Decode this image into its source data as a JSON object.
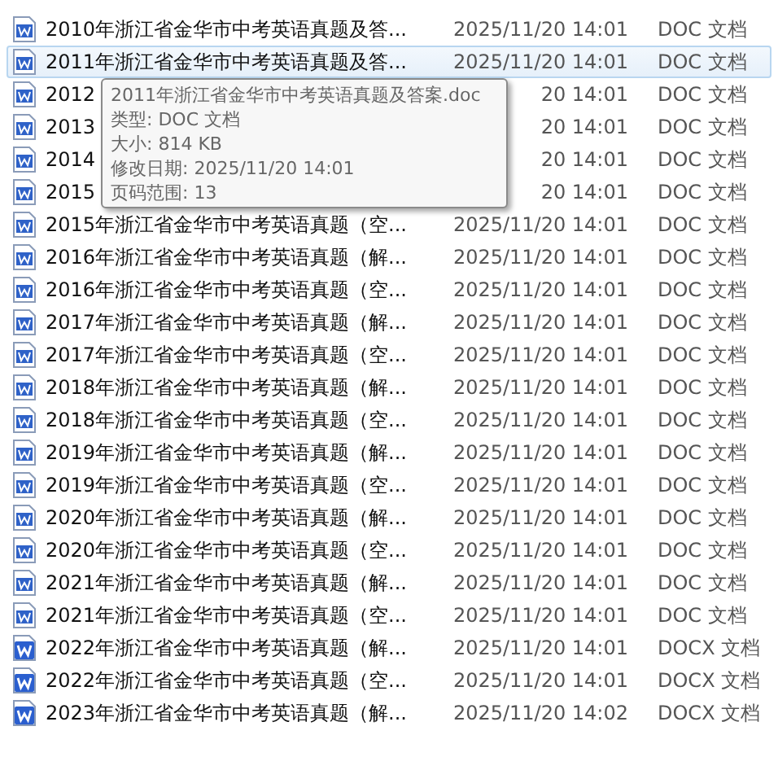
{
  "files": [
    {
      "name": "2010年浙江省金华市中考英语真题及答...",
      "date": "2025/11/20 14:01",
      "type": "DOC 文档",
      "kind": "doc",
      "selected": false
    },
    {
      "name": "2011年浙江省金华市中考英语真题及答...",
      "date": "2025/11/20 14:01",
      "type": "DOC 文档",
      "kind": "doc",
      "selected": true
    },
    {
      "name": "2012",
      "date": "20 14:01",
      "type": "DOC 文档",
      "kind": "doc",
      "selected": false
    },
    {
      "name": "2013",
      "date": "20 14:01",
      "type": "DOC 文档",
      "kind": "doc",
      "selected": false
    },
    {
      "name": "2014",
      "date": "20 14:01",
      "type": "DOC 文档",
      "kind": "doc",
      "selected": false
    },
    {
      "name": "2015",
      "date": "20 14:01",
      "type": "DOC 文档",
      "kind": "doc",
      "selected": false
    },
    {
      "name": "2015年浙江省金华市中考英语真题（空...",
      "date": "2025/11/20 14:01",
      "type": "DOC 文档",
      "kind": "doc",
      "selected": false
    },
    {
      "name": "2016年浙江省金华市中考英语真题（解...",
      "date": "2025/11/20 14:01",
      "type": "DOC 文档",
      "kind": "doc",
      "selected": false
    },
    {
      "name": "2016年浙江省金华市中考英语真题（空...",
      "date": "2025/11/20 14:01",
      "type": "DOC 文档",
      "kind": "doc",
      "selected": false
    },
    {
      "name": "2017年浙江省金华市中考英语真题（解...",
      "date": "2025/11/20 14:01",
      "type": "DOC 文档",
      "kind": "doc",
      "selected": false
    },
    {
      "name": "2017年浙江省金华市中考英语真题（空...",
      "date": "2025/11/20 14:01",
      "type": "DOC 文档",
      "kind": "doc",
      "selected": false
    },
    {
      "name": "2018年浙江省金华市中考英语真题（解...",
      "date": "2025/11/20 14:01",
      "type": "DOC 文档",
      "kind": "doc",
      "selected": false
    },
    {
      "name": "2018年浙江省金华市中考英语真题（空...",
      "date": "2025/11/20 14:01",
      "type": "DOC 文档",
      "kind": "doc",
      "selected": false
    },
    {
      "name": "2019年浙江省金华市中考英语真题（解...",
      "date": "2025/11/20 14:01",
      "type": "DOC 文档",
      "kind": "doc",
      "selected": false
    },
    {
      "name": "2019年浙江省金华市中考英语真题（空...",
      "date": "2025/11/20 14:01",
      "type": "DOC 文档",
      "kind": "doc",
      "selected": false
    },
    {
      "name": "2020年浙江省金华市中考英语真题（解...",
      "date": "2025/11/20 14:01",
      "type": "DOC 文档",
      "kind": "doc",
      "selected": false
    },
    {
      "name": "2020年浙江省金华市中考英语真题（空...",
      "date": "2025/11/20 14:01",
      "type": "DOC 文档",
      "kind": "doc",
      "selected": false
    },
    {
      "name": "2021年浙江省金华市中考英语真题（解...",
      "date": "2025/11/20 14:01",
      "type": "DOC 文档",
      "kind": "doc",
      "selected": false
    },
    {
      "name": "2021年浙江省金华市中考英语真题（空...",
      "date": "2025/11/20 14:01",
      "type": "DOC 文档",
      "kind": "doc",
      "selected": false
    },
    {
      "name": "2022年浙江省金华市中考英语真题（解...",
      "date": "2025/11/20 14:01",
      "type": "DOCX 文档",
      "kind": "docx",
      "selected": false
    },
    {
      "name": "2022年浙江省金华市中考英语真题（空...",
      "date": "2025/11/20 14:01",
      "type": "DOCX 文档",
      "kind": "docx",
      "selected": false
    },
    {
      "name": "2023年浙江省金华市中考英语真题（解...",
      "date": "2025/11/20 14:02",
      "type": "DOCX 文档",
      "kind": "docx",
      "selected": false
    }
  ],
  "tooltip": {
    "lines": [
      "2011年浙江省金华市中考英语真题及答案.doc",
      "类型: DOC 文档",
      "大小: 814 KB",
      "修改日期: 2025/11/20 14:01",
      "页码范围: 13"
    ]
  }
}
